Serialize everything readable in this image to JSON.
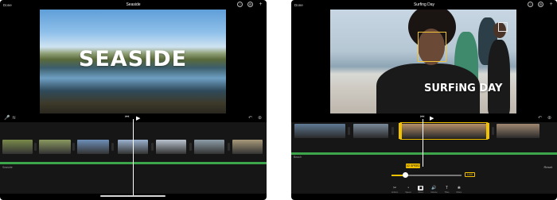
{
  "left": {
    "topbar": {
      "done": "Done",
      "title": "Seaside"
    },
    "overlay_title": "SEASIDE",
    "audio_label": "Seaside",
    "thumb_colors": [
      "#7a8a4a",
      "#8a9860",
      "#6d8fb8",
      "#9bb1cf",
      "#b9c3cf",
      "#8e9ea8",
      "#a89a7a"
    ]
  },
  "right": {
    "topbar": {
      "done": "Done",
      "title": "Surfing Day"
    },
    "overlay_title": "SURFiNG DAY",
    "audio_label": "Beach",
    "speed_value": "1/2 SPEED",
    "speed_end": "1/4X",
    "reset_label": "Reset",
    "speed_fraction": 0.2,
    "tools": [
      {
        "name": "actions",
        "glyph": "✂",
        "label": "Actions"
      },
      {
        "name": "speed",
        "glyph": "◔",
        "label": "Speed"
      },
      {
        "name": "clip-filter",
        "glyph": "▣",
        "label": "Filters"
      },
      {
        "name": "volume",
        "glyph": "🔊",
        "label": "Volume"
      },
      {
        "name": "titles",
        "glyph": "T",
        "label": "Titles"
      },
      {
        "name": "filters",
        "glyph": "❀",
        "label": "Filters"
      }
    ],
    "thumb_colors": [
      "#5f7a95",
      "#7a8a9a",
      "#b58f6a",
      "#a08872",
      "#8a7565",
      "#9aaab8",
      "#b0b7bc",
      "#6f7d86",
      "#c8c2b8"
    ]
  },
  "colors": {
    "accent": "#f2c100",
    "audio": "#3ea64a"
  }
}
